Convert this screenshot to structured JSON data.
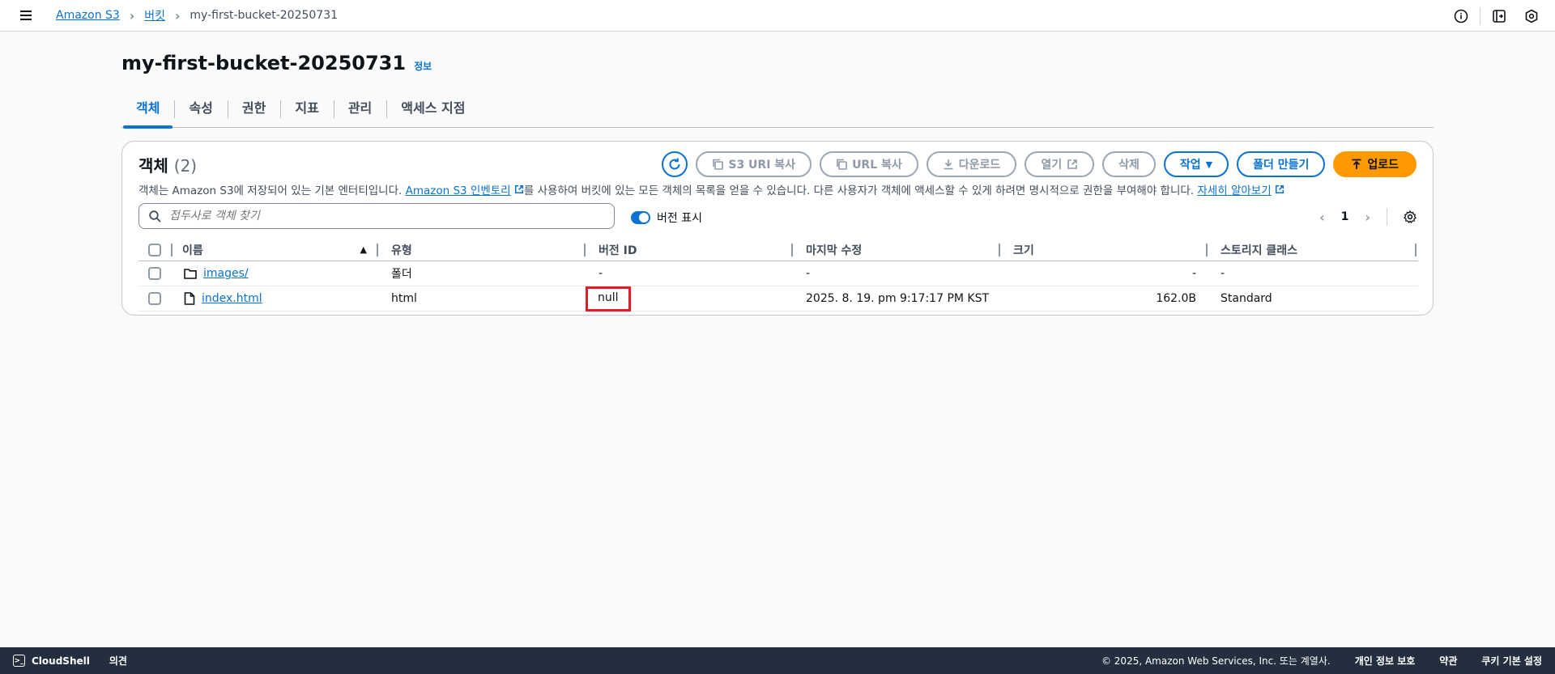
{
  "breadcrumb": {
    "items": [
      "Amazon S3",
      "버킷"
    ],
    "current": "my-first-bucket-20250731"
  },
  "page": {
    "title": "my-first-bucket-20250731",
    "info": "정보"
  },
  "tabs": [
    "객체",
    "속성",
    "권한",
    "지표",
    "관리",
    "액세스 지점"
  ],
  "objects": {
    "title": "객체",
    "count": "(2)",
    "actions": {
      "copy_s3_uri": "S3 URI 복사",
      "copy_url": "URL 복사",
      "download": "다운로드",
      "open": "열기",
      "delete": "삭제",
      "actions": "작업",
      "create_folder": "폴더 만들기",
      "upload": "업로드"
    },
    "description": {
      "part1": "객체는 Amazon S3에 저장되어 있는 기본 엔터티입니다.",
      "inventory_link": "Amazon S3 인벤토리",
      "part2": "를 사용하여 버킷에 있는 모든 객체의 목록을 얻을 수 있습니다. 다른 사용자가 객체에 액세스할 수 있게 하려면 명시적으로 권한을 부여해야 합니다.",
      "learn_more": "자세히 알아보기"
    },
    "search_placeholder": "접두사로 객체 찾기",
    "version_toggle": "버전 표시",
    "page_number": "1",
    "columns": [
      "이름",
      "유형",
      "버전 ID",
      "마지막 수정",
      "크기",
      "스토리지 클래스"
    ],
    "rows": [
      {
        "name": "images/",
        "type": "폴더",
        "version": "-",
        "modified": "-",
        "size": "-",
        "storage": "-"
      },
      {
        "name": "index.html",
        "type": "html",
        "version": "null",
        "modified": "2025. 8. 19. pm 9:17:17 PM KST",
        "size": "162.0B",
        "storage": "Standard"
      }
    ]
  },
  "footer": {
    "cloudshell": "CloudShell",
    "feedback": "의견",
    "copyright": "© 2025, Amazon Web Services, Inc. 또는 계열사.",
    "privacy": "개인 정보 보호",
    "terms": "약관",
    "cookies": "쿠키 기본 설정"
  },
  "colors": {
    "accent": "#0972d3",
    "upload": "#ff9900",
    "footer_bg": "#232f3e",
    "highlight": "#e11d2a"
  }
}
